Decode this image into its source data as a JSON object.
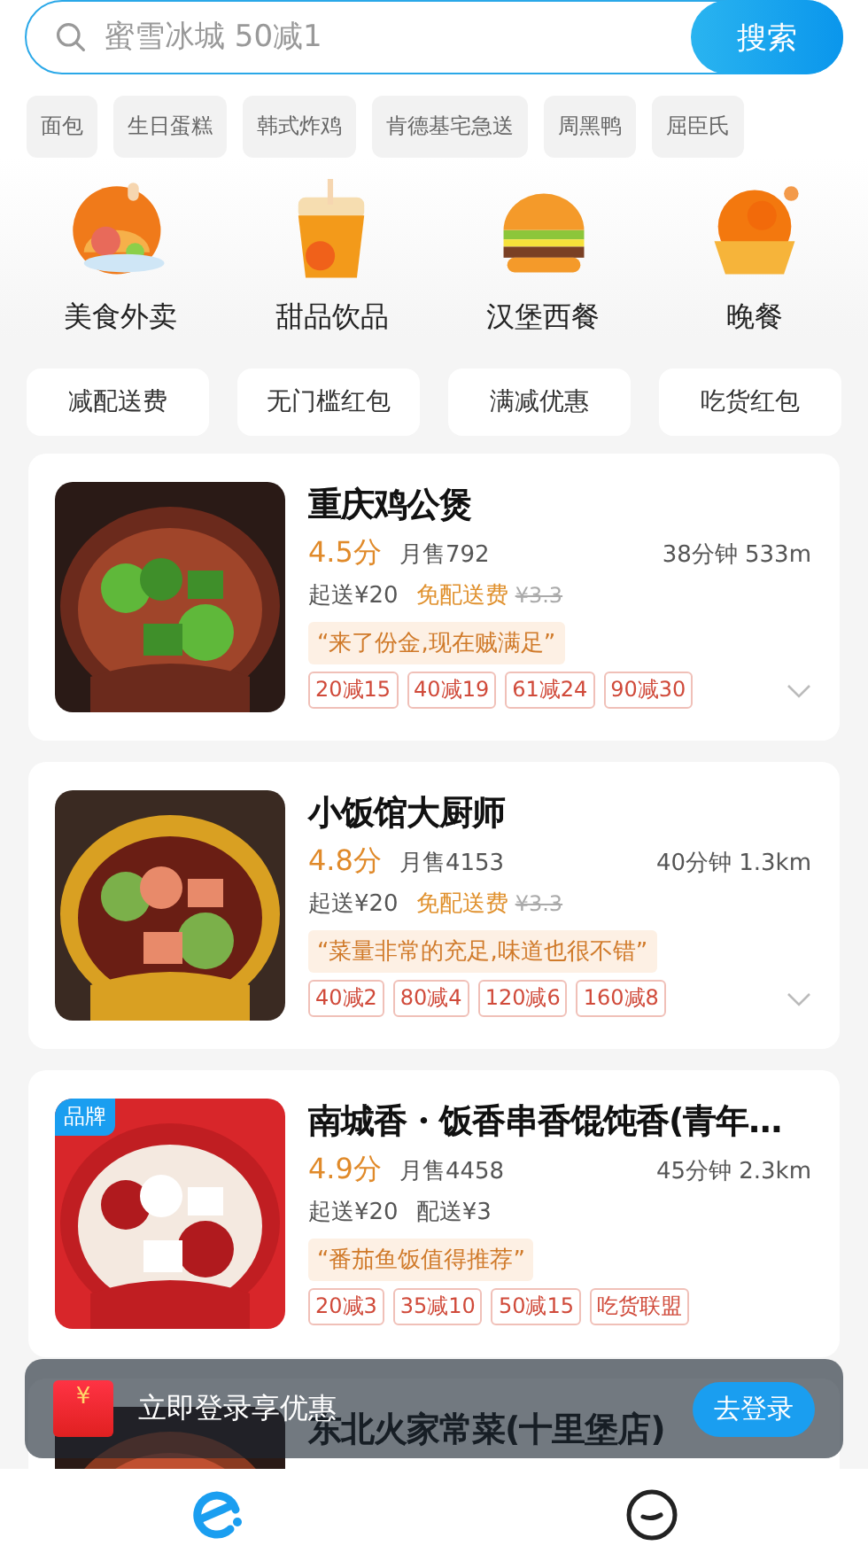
{
  "search": {
    "placeholder": "蜜雪冰城 50减1",
    "button": "搜索"
  },
  "hot_tags": [
    "面包",
    "生日蛋糕",
    "韩式炸鸡",
    "肯德基宅急送",
    "周黑鸭",
    "屈臣氏"
  ],
  "categories": [
    {
      "label": "美食外卖",
      "kind": "meal"
    },
    {
      "label": "甜品饮品",
      "kind": "drink"
    },
    {
      "label": "汉堡西餐",
      "kind": "burger"
    },
    {
      "label": "晚餐",
      "kind": "roast"
    }
  ],
  "promos": [
    "减配送费",
    "无门槛红包",
    "满减优惠",
    "吃货红包"
  ],
  "shops": [
    {
      "name": "重庆鸡公煲",
      "rating": "4.5分",
      "sales": "月售792",
      "eta": "38分钟 533m",
      "min_order": "起送¥20",
      "delivery": "免配送费",
      "delivery_free": true,
      "original_fee": "¥3.3",
      "review": "“来了份金,现在贼满足”",
      "discounts": [
        "20减15",
        "40减19",
        "61减24",
        "90减30"
      ],
      "expandable": true
    },
    {
      "name": "小饭馆大厨师",
      "rating": "4.8分",
      "sales": "月售4153",
      "eta": "40分钟 1.3km",
      "min_order": "起送¥20",
      "delivery": "免配送费",
      "delivery_free": true,
      "original_fee": "¥3.3",
      "review": "“菜量非常的充足,味道也很不错”",
      "discounts": [
        "40减2",
        "80减4",
        "120减6",
        "160减8"
      ],
      "expandable": true
    },
    {
      "badge": "品牌",
      "name": "南城香・饭香串香馄饨香(青年…",
      "rating": "4.9分",
      "sales": "月售4458",
      "eta": "45分钟 2.3km",
      "min_order": "起送¥20",
      "delivery": "配送¥3",
      "delivery_free": false,
      "review": "“番茄鱼饭值得推荐”",
      "discounts": [
        "20减3",
        "35减10",
        "50减15",
        "吃货联盟"
      ],
      "expandable": false
    },
    {
      "name": "东北火家常菜(十里堡店)"
    }
  ],
  "login_banner": {
    "symbol": "¥",
    "text": "立即登录享优惠",
    "button": "去登录"
  },
  "bottom_nav": [
    {
      "kind": "home",
      "selected": true
    },
    {
      "kind": "profile",
      "selected": false
    }
  ]
}
